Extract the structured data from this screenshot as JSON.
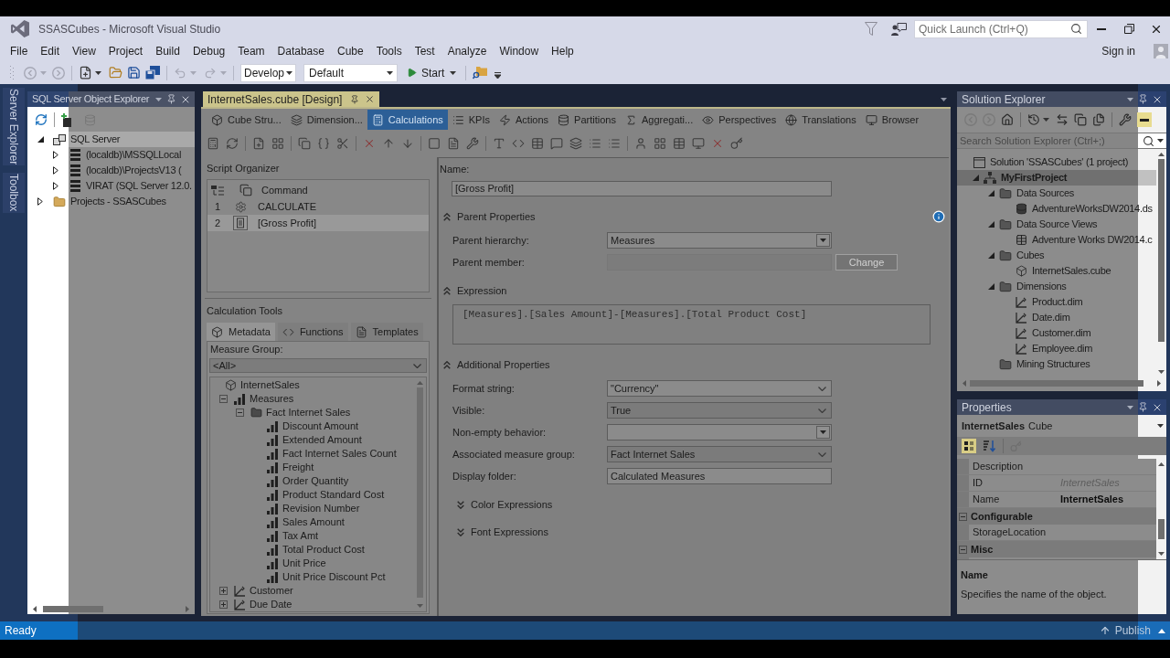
{
  "window": {
    "title": "SSASCubes - Microsoft Visual Studio",
    "quick_launch": {
      "placeholder": "Quick Launch (Ctrl+Q)"
    }
  },
  "menu": [
    "File",
    "Edit",
    "View",
    "Project",
    "Build",
    "Debug",
    "Team",
    "Database",
    "Cube",
    "Tools",
    "Test",
    "Analyze",
    "Window",
    "Help"
  ],
  "account": {
    "label": "Sign in"
  },
  "toolbar": {
    "configuration": "Develop",
    "platform": "Default",
    "start": "Start"
  },
  "side_tabs": [
    "Server Explorer",
    "Toolbox"
  ],
  "object_explorer": {
    "title": "SQL Server Object Explorer",
    "tree": [
      {
        "label": "SQL Server",
        "kind": "server_group",
        "expanded": true,
        "selected": true,
        "children": [
          {
            "label": "(localdb)\\MSSQLLocal",
            "kind": "server",
            "expanded": false,
            "selected": false
          },
          {
            "label": "(localdb)\\ProjectsV13 (",
            "kind": "server",
            "expanded": false,
            "selected": false
          },
          {
            "label": "VIRAT (SQL Server 12.0.",
            "kind": "server",
            "expanded": false,
            "selected": false
          }
        ]
      },
      {
        "label": "Projects - SSASCubes",
        "kind": "folder",
        "expanded": false,
        "selected": false
      }
    ]
  },
  "document": {
    "tab": {
      "label": "InternetSales.cube [Design]",
      "selected": true
    },
    "designer_tabs": [
      {
        "label": "Cube Stru...",
        "kind": "cube_structure",
        "selected": false
      },
      {
        "label": "Dimension...",
        "kind": "dimension_usage",
        "selected": false
      },
      {
        "label": "Calculations",
        "kind": "calculations",
        "selected": true
      },
      {
        "label": "KPIs",
        "kind": "kpis",
        "selected": false
      },
      {
        "label": "Actions",
        "kind": "actions",
        "selected": false
      },
      {
        "label": "Partitions",
        "kind": "partitions",
        "selected": false
      },
      {
        "label": "Aggregati...",
        "kind": "aggregations",
        "selected": false
      },
      {
        "label": "Perspectives",
        "kind": "perspectives",
        "selected": false
      },
      {
        "label": "Translations",
        "kind": "translations",
        "selected": false
      },
      {
        "label": "Browser",
        "kind": "browser",
        "selected": false
      }
    ],
    "script_organizer": {
      "title": "Script Organizer",
      "column": "Command",
      "rows": [
        {
          "number": "1",
          "kind": "calculate",
          "command": "CALCULATE",
          "selected": false
        },
        {
          "number": "2",
          "kind": "calculated_member",
          "command": "[Gross Profit]",
          "selected": true
        }
      ]
    },
    "calculation_tools": {
      "title": "Calculation Tools",
      "tabs": [
        {
          "label": "Metadata",
          "kind": "metadata",
          "selected": true
        },
        {
          "label": "Functions",
          "kind": "functions",
          "selected": false
        },
        {
          "label": "Templates",
          "kind": "templates",
          "selected": false
        }
      ],
      "measure_group_label": "Measure Group:",
      "measure_group": "<All>",
      "tree": [
        {
          "label": "InternetSales",
          "kind": "cube",
          "children": [
            {
              "label": "Measures",
              "kind": "measures",
              "expanded": true,
              "children": [
                {
                  "label": "Fact Internet Sales",
                  "kind": "measure_group",
                  "expanded": true,
                  "children": [
                    {
                      "label": "Discount Amount",
                      "kind": "measure"
                    },
                    {
                      "label": "Extended Amount",
                      "kind": "measure"
                    },
                    {
                      "label": "Fact Internet Sales Count",
                      "kind": "measure"
                    },
                    {
                      "label": "Freight",
                      "kind": "measure"
                    },
                    {
                      "label": "Order Quantity",
                      "kind": "measure"
                    },
                    {
                      "label": "Product Standard Cost",
                      "kind": "measure"
                    },
                    {
                      "label": "Revision Number",
                      "kind": "measure"
                    },
                    {
                      "label": "Sales Amount",
                      "kind": "measure"
                    },
                    {
                      "label": "Tax Amt",
                      "kind": "measure"
                    },
                    {
                      "label": "Total Product Cost",
                      "kind": "measure"
                    },
                    {
                      "label": "Unit Price",
                      "kind": "measure"
                    },
                    {
                      "label": "Unit Price Discount Pct",
                      "kind": "measure"
                    }
                  ]
                }
              ]
            },
            {
              "label": "Customer",
              "kind": "dimension",
              "expanded": false
            },
            {
              "label": "Due Date",
              "kind": "dimension",
              "expanded": false
            }
          ]
        }
      ]
    },
    "form": {
      "name": {
        "label": "Name:",
        "value": "[Gross Profit]"
      },
      "sections": [
        {
          "title": "Parent Properties",
          "expanded": true,
          "fields": [
            {
              "label": "Parent hierarchy:",
              "kind": "combo",
              "value": "Measures",
              "disabled": false
            },
            {
              "label": "Parent member:",
              "kind": "input",
              "disabled": true,
              "button": {
                "label": "Change",
                "disabled": true
              }
            }
          ]
        },
        {
          "title": "Expression",
          "expanded": true,
          "expression": "[Measures].[Sales Amount]-[Measures].[Total Product Cost]"
        },
        {
          "title": "Additional Properties",
          "expanded": true,
          "fields": [
            {
              "label": "Format string:",
              "kind": "editable_dropdown",
              "value": "\"Currency\"",
              "disabled": false
            },
            {
              "label": "Visible:",
              "kind": "dropdown_list",
              "value": "True",
              "disabled": false
            },
            {
              "label": "Non-empty behavior:",
              "kind": "combo",
              "disabled": false
            },
            {
              "label": "Associated measure group:",
              "kind": "dropdown_list",
              "value": "Fact Internet Sales",
              "disabled": false
            },
            {
              "label": "Display folder:",
              "kind": "input",
              "value": "Calculated Measures",
              "disabled": false
            }
          ],
          "subsections": [
            {
              "title": "Color Expressions",
              "expanded": false
            },
            {
              "title": "Font Expressions",
              "expanded": false
            }
          ]
        }
      ]
    }
  },
  "solution_explorer": {
    "title": "Solution Explorer",
    "search": {
      "placeholder": "Search Solution Explorer (Ctrl+;)"
    },
    "tree": [
      {
        "label": "Solution 'SSASCubes' (1 project)",
        "kind": "solution",
        "selected": false,
        "children": [
          {
            "label": "MyFirstProject",
            "kind": "project",
            "expanded": true,
            "selected": true,
            "children": [
              {
                "label": "Data Sources",
                "kind": "folder",
                "expanded": true,
                "selected": false,
                "children": [
                  {
                    "label": "AdventureWorksDW2014.ds",
                    "kind": "data_source",
                    "selected": false
                  }
                ]
              },
              {
                "label": "Data Source Views",
                "kind": "folder",
                "expanded": true,
                "selected": false,
                "children": [
                  {
                    "label": "Adventure Works DW2014.c",
                    "kind": "data_source_view",
                    "selected": false
                  }
                ]
              },
              {
                "label": "Cubes",
                "kind": "folder",
                "expanded": true,
                "selected": false,
                "children": [
                  {
                    "label": "InternetSales.cube",
                    "kind": "cube",
                    "selected": false
                  }
                ]
              },
              {
                "label": "Dimensions",
                "kind": "folder",
                "expanded": true,
                "selected": false,
                "children": [
                  {
                    "label": "Product.dim",
                    "kind": "dimension",
                    "selected": false
                  },
                  {
                    "label": "Date.dim",
                    "kind": "dimension",
                    "selected": false
                  },
                  {
                    "label": "Customer.dim",
                    "kind": "dimension",
                    "selected": false
                  },
                  {
                    "label": "Employee.dim",
                    "kind": "dimension",
                    "selected": false
                  }
                ]
              },
              {
                "label": "Mining Structures",
                "kind": "folder",
                "selected": false
              }
            ]
          }
        ]
      }
    ]
  },
  "properties": {
    "title": "Properties",
    "object": {
      "name": "InternetSales",
      "type": "Cube"
    },
    "views": [
      {
        "kind": "categorized",
        "selected": true
      },
      {
        "kind": "alphabetical",
        "selected": false
      }
    ],
    "rows": [
      {
        "kind": "property",
        "name": "Description"
      },
      {
        "kind": "property",
        "name": "ID",
        "value": "InternetSales",
        "read_only": true,
        "modified": false
      },
      {
        "kind": "property",
        "name": "Name",
        "value": "InternetSales",
        "read_only": false,
        "modified": true
      },
      {
        "kind": "category",
        "name": "Configurable",
        "expanded": true
      },
      {
        "kind": "property",
        "name": "StorageLocation"
      },
      {
        "kind": "category",
        "name": "Misc",
        "expanded": true
      }
    ],
    "description": {
      "title": "Name",
      "text": "Specifies the name of the object."
    }
  },
  "status_bar": {
    "text": "Ready",
    "publish": "Publish"
  }
}
